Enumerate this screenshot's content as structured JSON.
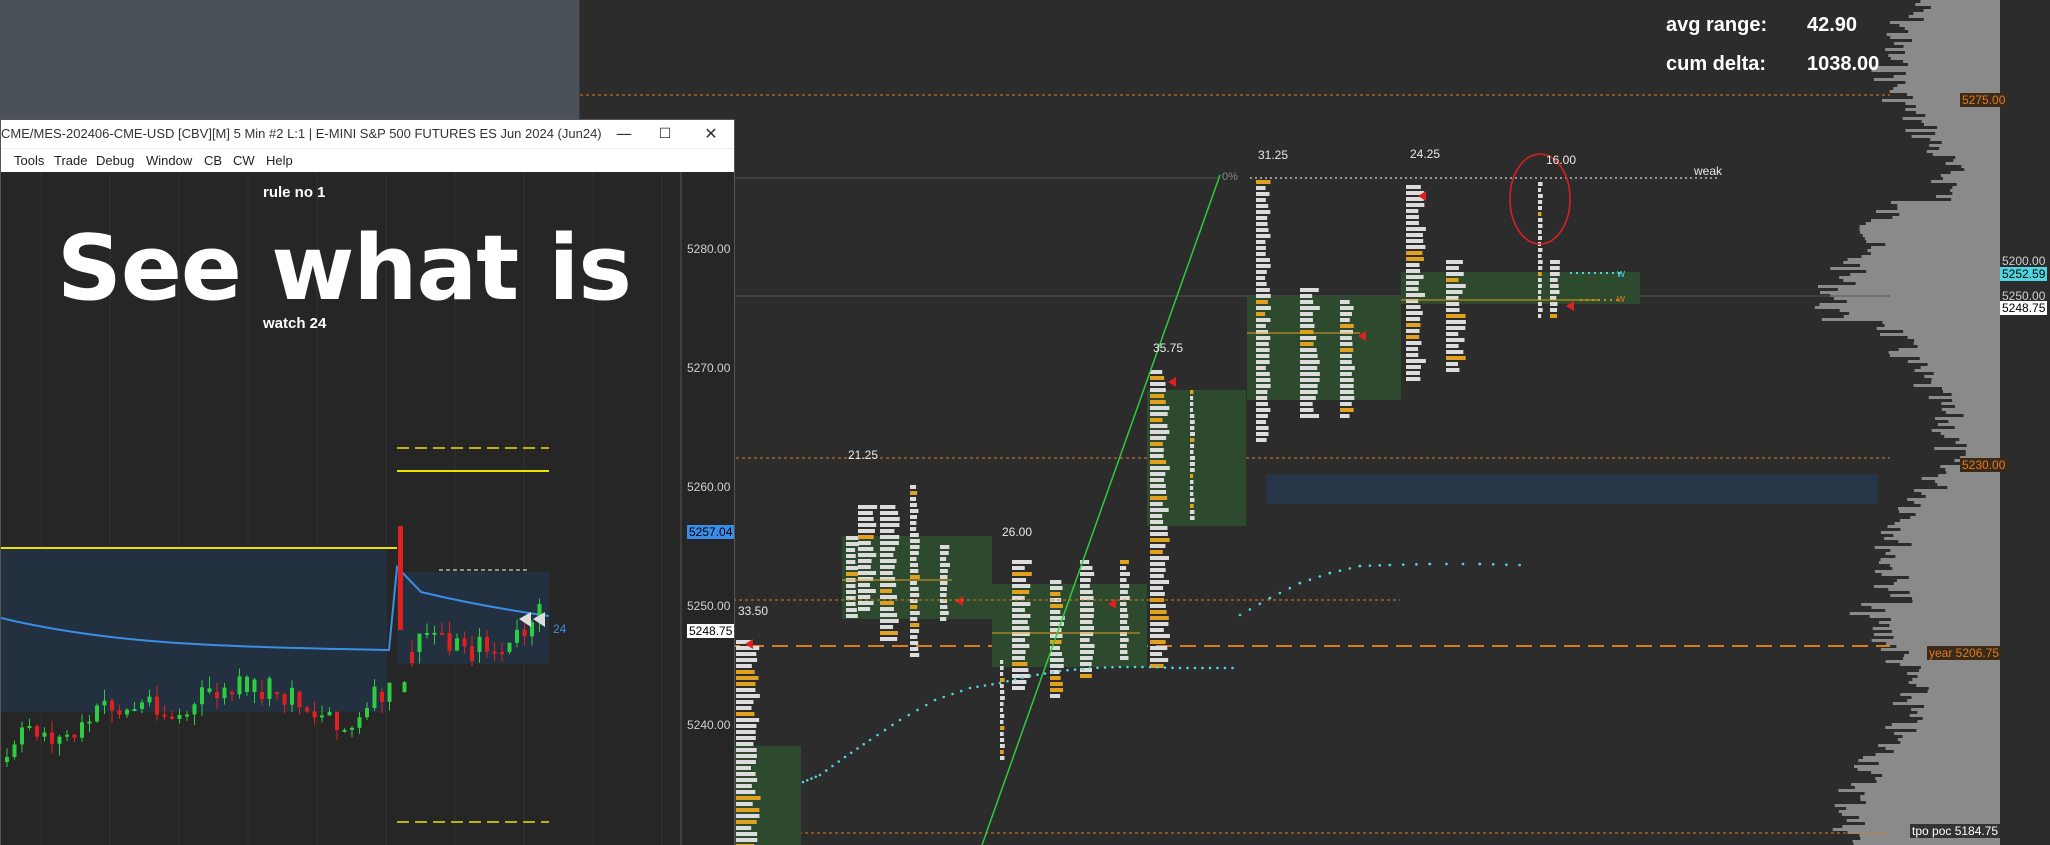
{
  "stats": {
    "avg_range_label": "avg range:",
    "avg_range_value": "42.90",
    "cum_delta_label": "cum delta:",
    "cum_delta_value": "1038.00"
  },
  "main_axis": {
    "price_labels": [
      "5280.00",
      "5270.00",
      "5260.00",
      "5250.00",
      "5240.00",
      "5200.00"
    ],
    "badges": [
      {
        "text": "5275.00",
        "color": "#e07b20",
        "bg": "#3a2a1a"
      },
      {
        "text": "5252.59",
        "color": "#000000",
        "bg": "#4fd6e0"
      },
      {
        "text": "5250.00",
        "color": "#d0d0d0",
        "bg": "transparent"
      },
      {
        "text": "5248.75",
        "color": "#000000",
        "bg": "#ffffff"
      },
      {
        "text": "5230.00",
        "color": "#e07b20",
        "bg": "#3a2a1a"
      },
      {
        "text": "year  5206.75",
        "color": "#e07b20",
        "bg": "#3a2a1a"
      },
      {
        "text": "tpo poc  5184.75",
        "color": "#ffffff",
        "bg": "#333333"
      }
    ]
  },
  "range_labels": [
    "33.50",
    "21.25",
    "26.00",
    "35.75",
    "31.25",
    "24.25",
    "16.00"
  ],
  "annotations": {
    "weak": "weak",
    "pct": "0%",
    "w1": "w",
    "w2": "w"
  },
  "window": {
    "title": "CME/MES-202406-CME-USD [CBV][M]  5 Min  #2 L:1 | E-MINI S&P 500 FUTURES ES Jun 2024 (Jun24)",
    "minimize": "—",
    "maximize": "☐",
    "close": "✕",
    "menu": [
      "Tools",
      "Trade",
      "Debug",
      "Window",
      "CB",
      "CW",
      "Help"
    ],
    "rule": "rule no 1",
    "headline": "See what is",
    "watch": "watch 24",
    "axis_labels": [
      "5280.00",
      "5270.00",
      "5260.00",
      "5250.00",
      "5240.00"
    ],
    "badge_blue": "5257.04",
    "badge_white": "5248.75",
    "label_24": "24"
  },
  "colors": {
    "background": "#2c2c2c",
    "tpo_green": "#2e4a2e",
    "orange": "#e07b20",
    "cyan": "#4fd6e0",
    "yellow": "#f0e000",
    "blue_line": "#3a8ee8"
  }
}
